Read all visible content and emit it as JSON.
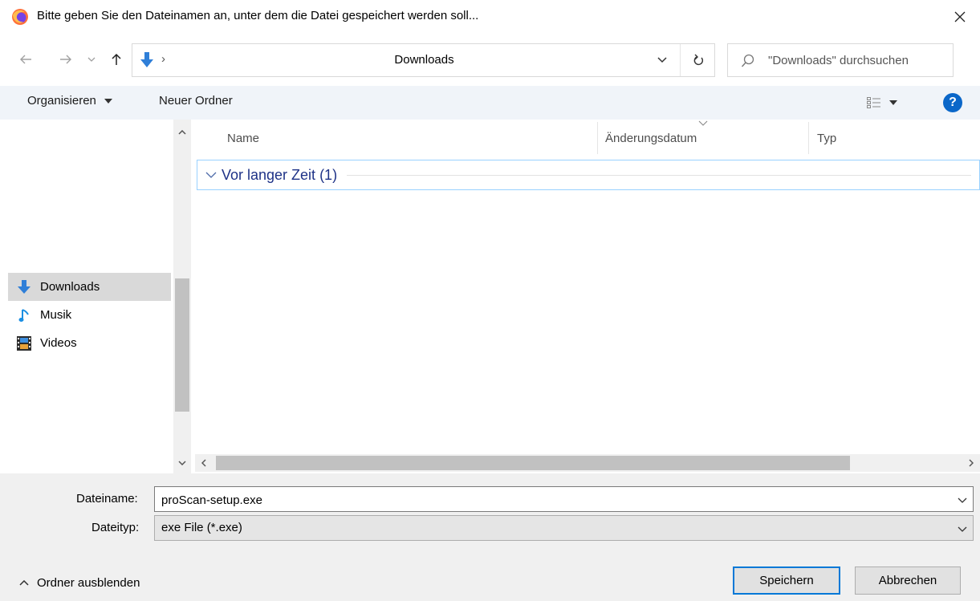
{
  "window": {
    "title": "Bitte geben Sie den Dateinamen an, unter dem die Datei gespeichert werden soll..."
  },
  "address_bar": {
    "location": "Downloads",
    "separator": "›"
  },
  "search": {
    "placeholder": "\"Downloads\" durchsuchen"
  },
  "toolbar": {
    "organize_label": "Organisieren",
    "new_folder_label": "Neuer Ordner",
    "help_label": "?"
  },
  "navigation_pane": {
    "items": [
      {
        "label": "Downloads",
        "icon": "download-arrow-icon",
        "selected": true
      },
      {
        "label": "Musik",
        "icon": "music-note-icon",
        "selected": false
      },
      {
        "label": "Videos",
        "icon": "film-strip-icon",
        "selected": false
      }
    ]
  },
  "file_list": {
    "columns": [
      "Name",
      "Änderungsdatum",
      "Typ"
    ],
    "group_label": "Vor langer Zeit (1)"
  },
  "save_form": {
    "filename_label": "Dateiname:",
    "filename_value": "proScan-setup.exe",
    "filetype_label": "Dateityp:",
    "filetype_value": "exe File (*.exe)"
  },
  "footer": {
    "hide_folders_label": "Ordner ausblenden",
    "save_button": "Speichern",
    "cancel_button": "Abbrechen"
  },
  "colors": {
    "accent": "#0078d7",
    "toolbar_bg": "#f0f4f9",
    "group_header_text": "#1e3287",
    "selection_bg": "#d9d9d9"
  }
}
